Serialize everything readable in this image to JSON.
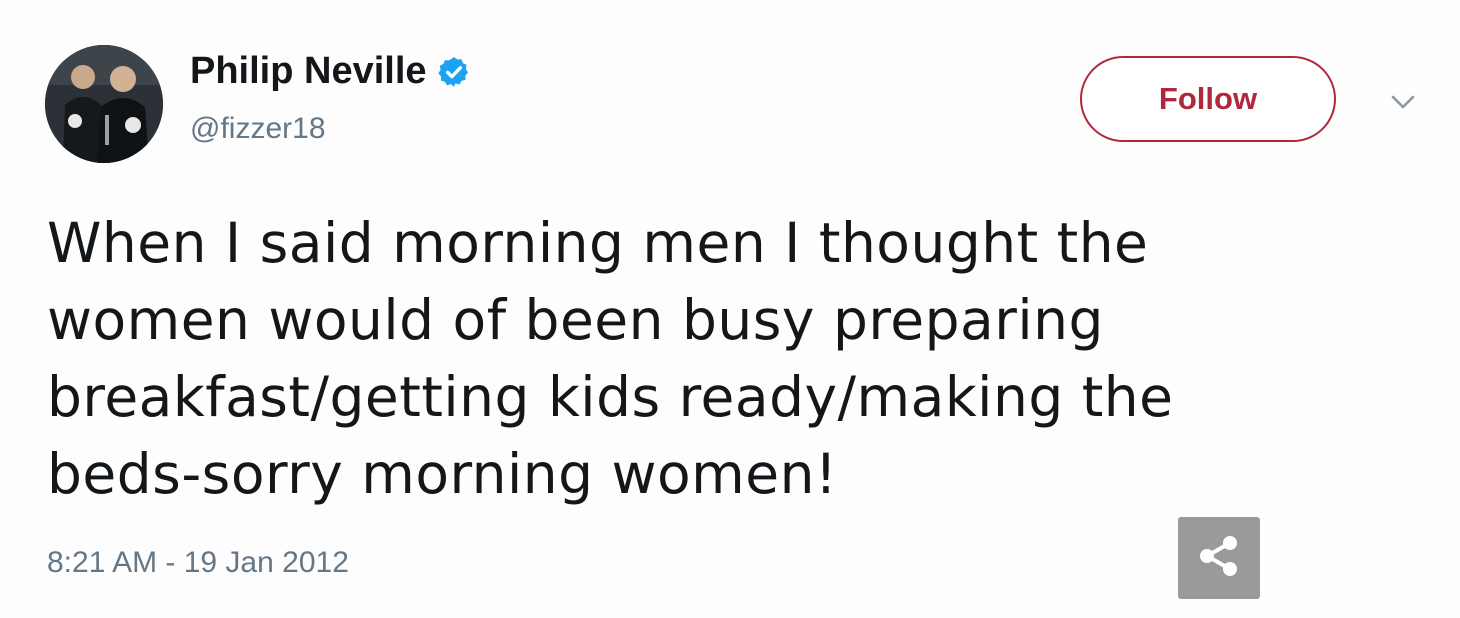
{
  "author": {
    "display_name": "Philip Neville",
    "handle": "@fizzer18",
    "verified": true,
    "avatar_icon": "profile-photo"
  },
  "actions": {
    "follow_label": "Follow",
    "menu_icon": "chevron-down-icon",
    "share_icon": "share-icon"
  },
  "tweet": {
    "lines": [
      "When I said morning men I thought the",
      "women would of been busy preparing",
      "breakfast/getting kids ready/making the",
      "beds-sorry morning women!"
    ],
    "timestamp": "8:21 AM - 19 Jan 2012"
  },
  "colors": {
    "follow_accent": "#b0283c",
    "verified_blue": "#1da1f2",
    "secondary_text": "#657786",
    "share_bg": "#9a9a9a"
  }
}
